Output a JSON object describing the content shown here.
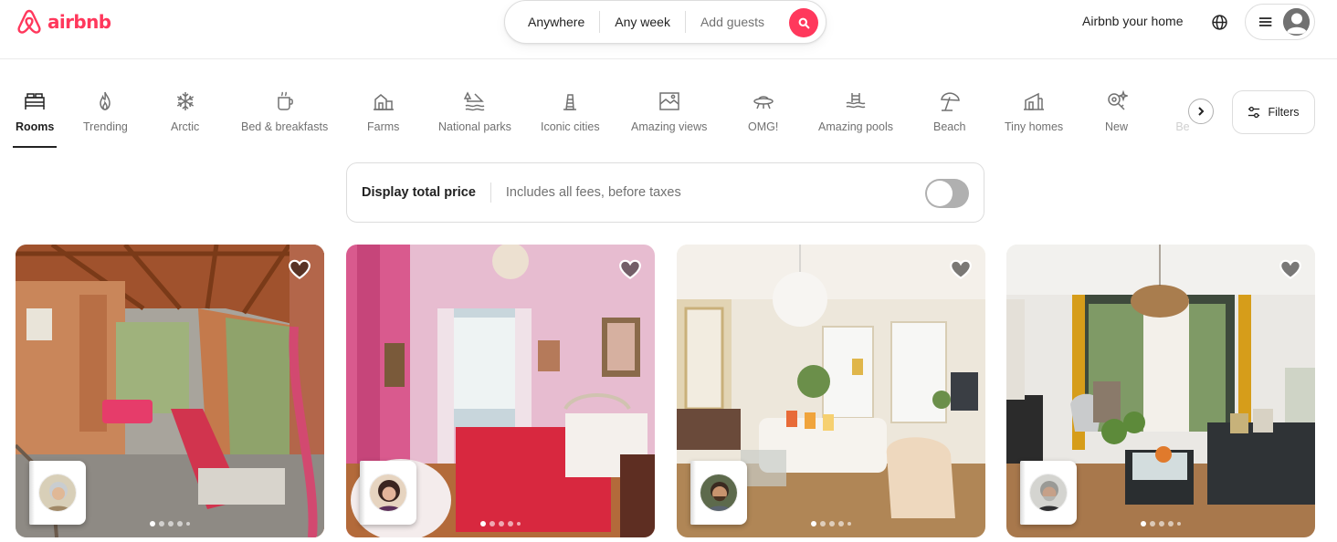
{
  "brand": {
    "name": "airbnb",
    "color": "#FF385C"
  },
  "search": {
    "where": "Anywhere",
    "when": "Any week",
    "guests": "Add guests",
    "icon": "search-icon"
  },
  "header": {
    "host_link": "Airbnb your home",
    "globe_icon": "globe-icon",
    "menu_icon": "hamburger-icon",
    "avatar_icon": "user-avatar-icon"
  },
  "categories": {
    "items": [
      {
        "label": "Rooms",
        "icon": "bed-icon",
        "active": true
      },
      {
        "label": "Trending",
        "icon": "flame-icon"
      },
      {
        "label": "Arctic",
        "icon": "snowflake-icon"
      },
      {
        "label": "Bed & breakfasts",
        "icon": "coffee-cup-icon"
      },
      {
        "label": "Farms",
        "icon": "barn-icon"
      },
      {
        "label": "National parks",
        "icon": "park-icon"
      },
      {
        "label": "Iconic cities",
        "icon": "tower-icon"
      },
      {
        "label": "Amazing views",
        "icon": "landscape-icon"
      },
      {
        "label": "OMG!",
        "icon": "ufo-icon"
      },
      {
        "label": "Amazing pools",
        "icon": "pool-icon"
      },
      {
        "label": "Beach",
        "icon": "umbrella-icon"
      },
      {
        "label": "Tiny homes",
        "icon": "tiny-home-icon"
      },
      {
        "label": "New",
        "icon": "sparkle-key-icon"
      },
      {
        "label": "Be",
        "icon": "",
        "faded": true
      }
    ],
    "next_icon": "chevron-right-icon",
    "filters_label": "Filters",
    "filters_icon": "sliders-icon"
  },
  "total_price": {
    "title": "Display total price",
    "subtitle": "Includes all fees, before taxes",
    "enabled": false
  },
  "listings": [
    {
      "photo": "sunroom-with-hammock",
      "host_photo": "host-grey-hair-woman",
      "heart_icon": "heart-icon",
      "photo_index": 1,
      "photo_count": 5
    },
    {
      "photo": "pink-bedroom",
      "host_photo": "host-dark-hair-woman",
      "heart_icon": "heart-icon",
      "photo_index": 1,
      "photo_count": 5
    },
    {
      "photo": "bright-living-room",
      "host_photo": "host-bearded-man",
      "heart_icon": "heart-icon",
      "photo_index": 1,
      "photo_count": 5
    },
    {
      "photo": "living-room-with-fireplace",
      "host_photo": "host-grey-beard-man",
      "heart_icon": "heart-icon",
      "photo_index": 1,
      "photo_count": 5
    }
  ]
}
